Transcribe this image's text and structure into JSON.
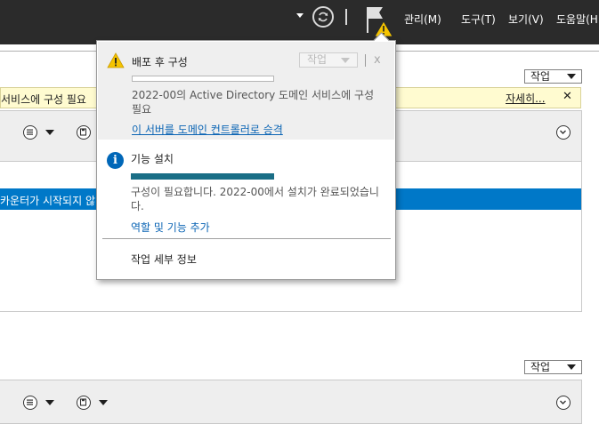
{
  "menubar": {
    "items": [
      "관리(M)",
      "도구(T)",
      "보기(V)",
      "도움말(H"
    ]
  },
  "dashboard": {
    "task_label": "작업",
    "yellow_message": "서비스에 구성 필요",
    "detail_link": "자세히...",
    "close_symbol": "✕",
    "selected_row_text": "카운터가 시작되지 않",
    "task_label_2": "작업"
  },
  "popup": {
    "section1": {
      "title": "배포 후 구성",
      "task_button": "작업",
      "close_symbol": "x",
      "progress": 0,
      "message": "2022-00의 Active Directory 도메인 서비스에 구성 필요",
      "link": "이 서버를 도메인 컨트롤러로 승격"
    },
    "section2": {
      "title": "기능 설치",
      "progress": 1.0,
      "message": "구성이 필요합니다. 2022-00에서 설치가 완료되었습니다.",
      "link": "역할 및 기능 추가"
    },
    "task_details": "작업 세부 정보"
  },
  "colors": {
    "menubar_bg": "#2b2b2b",
    "warning_yellow": "#f5c400",
    "info_blue": "#0067b8",
    "link_blue": "#0a64b4",
    "selection_blue": "#0078c8",
    "progress_fill": "#1a6e86"
  }
}
